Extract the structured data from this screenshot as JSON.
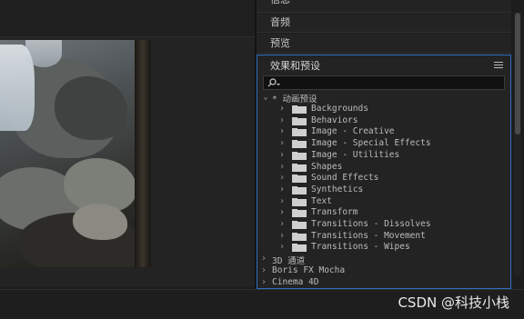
{
  "panels": {
    "info_label": "信息",
    "audio_label": "音频",
    "preview_label": "预览"
  },
  "effects": {
    "title": "效果和预设",
    "search": {
      "value": "",
      "placeholder": ""
    },
    "animation_presets_label": "* 动画预设",
    "presets": [
      "Backgrounds",
      "Behaviors",
      "Image - Creative",
      "Image - Special Effects",
      "Image - Utilities",
      "Shapes",
      "Sound Effects",
      "Synthetics",
      "Text",
      "Transform",
      "Transitions - Dissolves",
      "Transitions - Movement",
      "Transitions - Wipes"
    ],
    "categories": [
      "3D 通道",
      "Boris FX Mocha",
      "Cinema 4D"
    ]
  },
  "watermark": "CSDN @科技小栈"
}
